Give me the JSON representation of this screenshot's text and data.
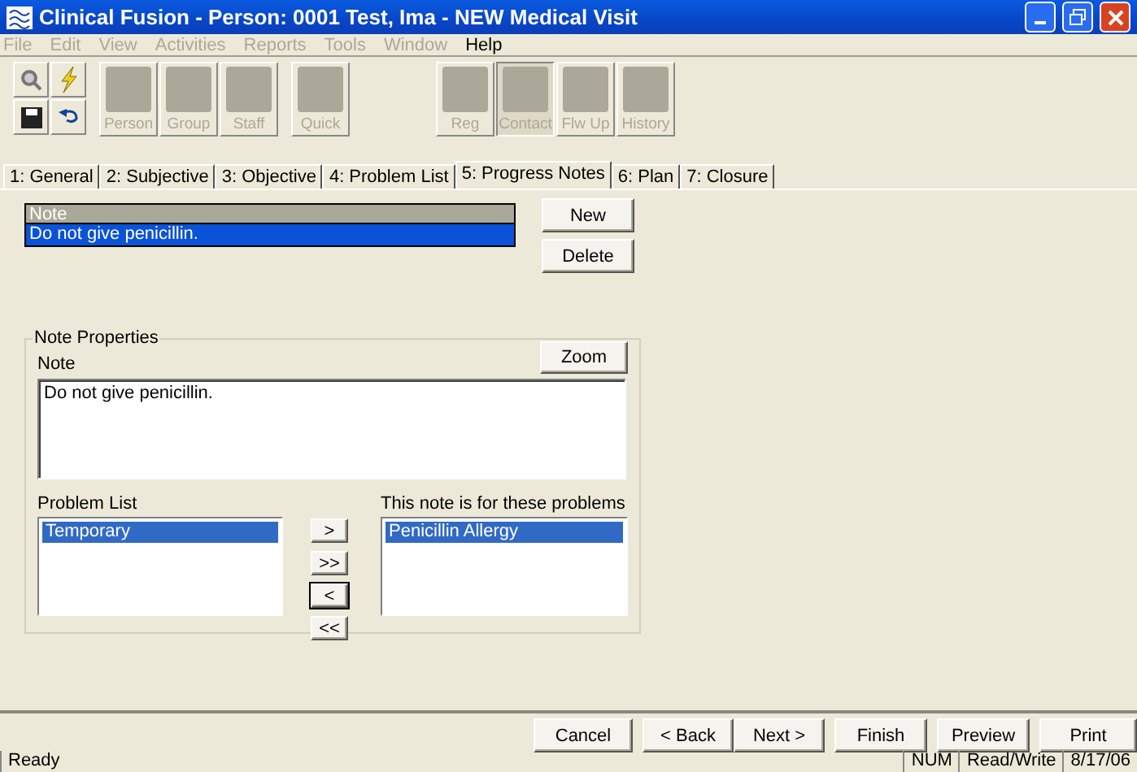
{
  "window": {
    "title": "Clinical Fusion - Person: 0001 Test, Ima -  NEW Medical Visit"
  },
  "menu": [
    {
      "label": "File",
      "disabled": true
    },
    {
      "label": "Edit",
      "disabled": true
    },
    {
      "label": "View",
      "disabled": true
    },
    {
      "label": "Activities",
      "disabled": true
    },
    {
      "label": "Reports",
      "disabled": true
    },
    {
      "label": "Tools",
      "disabled": true
    },
    {
      "label": "Window",
      "disabled": true
    },
    {
      "label": "Help",
      "disabled": false
    }
  ],
  "toolbar": [
    {
      "label": "Person",
      "pressed": false
    },
    {
      "label": "Group",
      "pressed": false
    },
    {
      "label": "Staff",
      "pressed": false
    },
    {
      "label": "Quick",
      "pressed": false
    },
    {
      "label": "Reg",
      "pressed": false
    },
    {
      "label": "Contact",
      "pressed": true
    },
    {
      "label": "Flw Up",
      "pressed": false
    },
    {
      "label": "History",
      "pressed": false
    }
  ],
  "tabs": [
    {
      "label": "1: General",
      "selected": false
    },
    {
      "label": "2: Subjective",
      "selected": false
    },
    {
      "label": "3: Objective",
      "selected": false
    },
    {
      "label": "4: Problem List",
      "selected": false
    },
    {
      "label": "5: Progress Notes",
      "selected": true
    },
    {
      "label": "6: Plan",
      "selected": false
    },
    {
      "label": "7: Closure",
      "selected": false
    }
  ],
  "notes_table": {
    "columns": [
      "Note"
    ],
    "rows": [
      {
        "note": "Do not give penicillin.",
        "selected": true
      }
    ]
  },
  "note_buttons": [
    "New",
    "Delete"
  ],
  "note_properties": {
    "title": "Note Properties",
    "note_label": "Note",
    "zoom_button": "Zoom",
    "note_value": "Do not give penicillin.",
    "problem_list": {
      "label": "Problem List",
      "items": [
        {
          "label": "Temporary",
          "selected": true
        }
      ]
    },
    "move_buttons": [
      {
        "label": ">",
        "focused": false
      },
      {
        "label": ">>",
        "focused": false
      },
      {
        "label": "<",
        "focused": true
      },
      {
        "label": "<<",
        "focused": false
      }
    ],
    "linked_problems": {
      "label": "This note is for these problems",
      "items": [
        {
          "label": "Penicillin Allergy",
          "selected": true
        }
      ]
    }
  },
  "wizard_buttons": [
    "Cancel",
    "< Back",
    "Next >",
    "Finish",
    "Preview",
    "Print"
  ],
  "status_bar": [
    "Ready",
    "NUM",
    "Read/Write",
    "8/17/06"
  ]
}
